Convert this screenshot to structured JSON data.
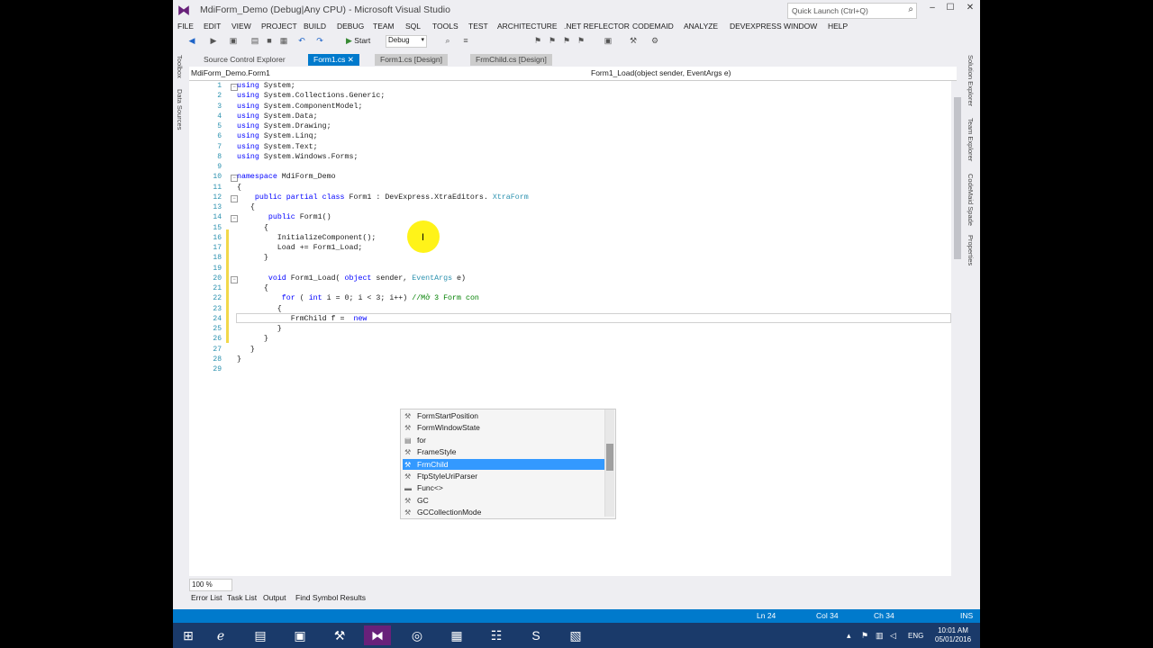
{
  "window": {
    "title": "MdiForm_Demo (Debug|Any CPU) - Microsoft Visual Studio",
    "quick_launch_placeholder": "Quick Launch (Ctrl+Q)",
    "min": "–",
    "max": "☐",
    "close": "✕"
  },
  "menu": [
    "FILE",
    "EDIT",
    "VIEW",
    "PROJECT",
    "BUILD",
    "DEBUG",
    "TEAM",
    "SQL",
    "TOOLS",
    "TEST",
    "ARCHITECTURE",
    ".NET REFLECTOR",
    "CODEMAID",
    "ANALYZE",
    "DEVEXPRESS",
    "WINDOW",
    "HELP"
  ],
  "toolbar": {
    "start_label": "Start",
    "config": "Debug"
  },
  "left_strip": [
    "Toolbox",
    "Data Sources"
  ],
  "right_strip": [
    "Solution Explorer",
    "Team Explorer",
    "CodeMaid Spade",
    "Properties"
  ],
  "tabs": [
    "Source Control Explorer",
    "Form1.cs",
    "Form1.cs [Design]",
    "FrmChild.cs [Design]"
  ],
  "nav": {
    "left": "MdiForm_Demo.Form1",
    "right": "Form1_Load(object sender, EventArgs e)"
  },
  "code_lines": [
    {
      "n": "1",
      "t": [
        [
          "kw",
          "using"
        ],
        [
          "",
          "System;"
        ]
      ]
    },
    {
      "n": "2",
      "t": [
        [
          "kw",
          "using"
        ],
        [
          "",
          "System.Collections.Generic;"
        ]
      ]
    },
    {
      "n": "3",
      "t": [
        [
          "kw",
          "using"
        ],
        [
          "",
          "System.ComponentModel;"
        ]
      ]
    },
    {
      "n": "4",
      "t": [
        [
          "kw",
          "using"
        ],
        [
          "",
          "System.Data;"
        ]
      ]
    },
    {
      "n": "5",
      "t": [
        [
          "kw",
          "using"
        ],
        [
          "",
          "System.Drawing;"
        ]
      ]
    },
    {
      "n": "6",
      "t": [
        [
          "kw",
          "using"
        ],
        [
          "",
          "System.Linq;"
        ]
      ]
    },
    {
      "n": "7",
      "t": [
        [
          "kw",
          "using"
        ],
        [
          "",
          "System.Text;"
        ]
      ]
    },
    {
      "n": "8",
      "t": [
        [
          "kw",
          "using"
        ],
        [
          "",
          "System.Windows.Forms;"
        ]
      ]
    },
    {
      "n": "9",
      "t": []
    },
    {
      "n": "10",
      "t": [
        [
          "kw",
          "namespace"
        ],
        [
          "",
          "MdiForm_Demo"
        ]
      ]
    },
    {
      "n": "11",
      "t": [
        [
          "",
          "{"
        ]
      ]
    },
    {
      "n": "12",
      "t": [
        [
          "",
          "   "
        ],
        [
          "kw",
          "public partial class"
        ],
        [
          "",
          "Form1 : DevExpress.XtraEditors."
        ],
        [
          "ty",
          "XtraForm"
        ]
      ]
    },
    {
      "n": "13",
      "t": [
        [
          "",
          "   {"
        ]
      ]
    },
    {
      "n": "14",
      "t": [
        [
          "",
          "      "
        ],
        [
          "kw",
          "public"
        ],
        [
          "",
          "Form1()"
        ]
      ]
    },
    {
      "n": "15",
      "t": [
        [
          "",
          "      {"
        ]
      ]
    },
    {
      "n": "16",
      "t": [
        [
          "",
          "         InitializeComponent();"
        ]
      ]
    },
    {
      "n": "17",
      "t": [
        [
          "",
          "         Load += Form1_Load;"
        ]
      ]
    },
    {
      "n": "18",
      "t": [
        [
          "",
          "      }"
        ]
      ]
    },
    {
      "n": "19",
      "t": []
    },
    {
      "n": "20",
      "t": [
        [
          "",
          "      "
        ],
        [
          "kw",
          "void"
        ],
        [
          "",
          "Form1_Load("
        ],
        [
          "kw",
          "object"
        ],
        [
          "",
          "sender,"
        ],
        [
          "ty",
          "EventArgs"
        ],
        [
          "",
          "e)"
        ]
      ]
    },
    {
      "n": "21",
      "t": [
        [
          "",
          "      {"
        ]
      ]
    },
    {
      "n": "22",
      "t": [
        [
          "",
          "         "
        ],
        [
          "kw",
          "for"
        ],
        [
          "",
          "("
        ],
        [
          "kw",
          "int"
        ],
        [
          "",
          "i = 0; i < 3; i++)"
        ],
        [
          "cm",
          "//Mở 3 Form con"
        ]
      ]
    },
    {
      "n": "23",
      "t": [
        [
          "",
          "         {"
        ]
      ]
    },
    {
      "n": "24",
      "t": [
        [
          "",
          "            FrmChild f = "
        ],
        [
          "kw",
          "new"
        ]
      ]
    },
    {
      "n": "25",
      "t": [
        [
          "",
          "         }"
        ]
      ]
    },
    {
      "n": "26",
      "t": [
        [
          "",
          "      }"
        ]
      ]
    },
    {
      "n": "27",
      "t": [
        [
          "",
          "   }"
        ]
      ]
    },
    {
      "n": "28",
      "t": [
        [
          "",
          "}"
        ]
      ]
    },
    {
      "n": "29",
      "t": []
    }
  ],
  "intellisense": [
    {
      "icon": "⚒",
      "label": "FormStartPosition"
    },
    {
      "icon": "⚒",
      "label": "FormWindowState"
    },
    {
      "icon": "▤",
      "label": "for"
    },
    {
      "icon": "⚒",
      "label": "FrameStyle"
    },
    {
      "icon": "⚒",
      "label": "FrmChild",
      "selected": true
    },
    {
      "icon": "⚒",
      "label": "FtpStyleUriParser"
    },
    {
      "icon": "▬",
      "label": "Func<>"
    },
    {
      "icon": "⚒",
      "label": "GC"
    },
    {
      "icon": "⚒",
      "label": "GCCollectionMode"
    }
  ],
  "zoom": "100 %",
  "bottom_tabs": [
    "Error List",
    "Task List",
    "Output",
    "Find Symbol Results"
  ],
  "status": {
    "ln": "Ln 24",
    "col": "Col 34",
    "ch": "Ch 34",
    "mode": "INS"
  },
  "taskbar": {
    "lang": "ENG",
    "time": "10:01 AM",
    "date": "05/01/2016"
  }
}
